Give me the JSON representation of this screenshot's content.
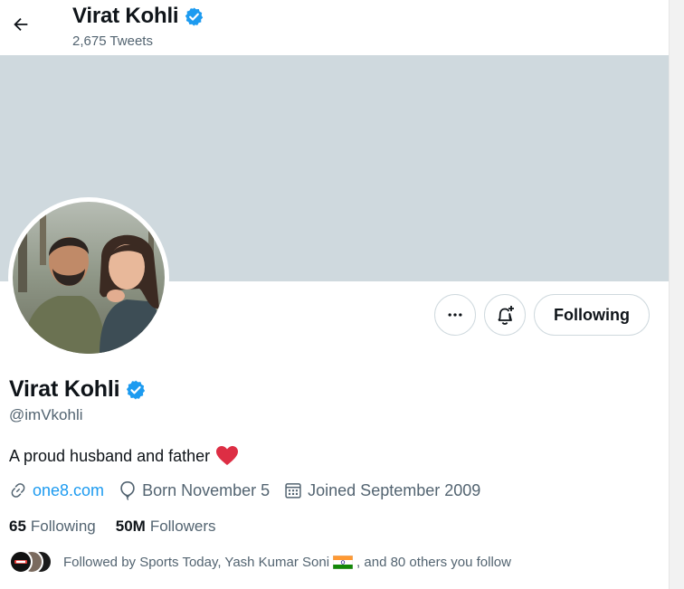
{
  "header": {
    "name": "Virat Kohli",
    "tweet_count": "2,675 Tweets"
  },
  "profile": {
    "name": "Virat Kohli",
    "handle": "@imVkohli",
    "bio": "A proud husband and father",
    "website": "one8.com",
    "birthday": "Born November 5",
    "joined": "Joined September 2009",
    "following_count": "65",
    "following_label": "Following",
    "followers_count": "50M",
    "followers_label": "Followers",
    "followed_by_prefix": "Followed by Sports Today, Yash Kumar Soni",
    "followed_by_suffix": ", and 80 others you follow"
  },
  "actions": {
    "following_button": "Following"
  },
  "colors": {
    "accent": "#1d9bf0",
    "banner": "#cfd9de",
    "verified": "#1d9bf0",
    "heart": "#e0245e"
  },
  "icons": [
    "back-arrow-icon",
    "verified-badge-icon",
    "more-icon",
    "bell-plus-icon",
    "link-icon",
    "balloon-icon",
    "calendar-icon",
    "red-heart-icon",
    "india-flag-icon"
  ]
}
